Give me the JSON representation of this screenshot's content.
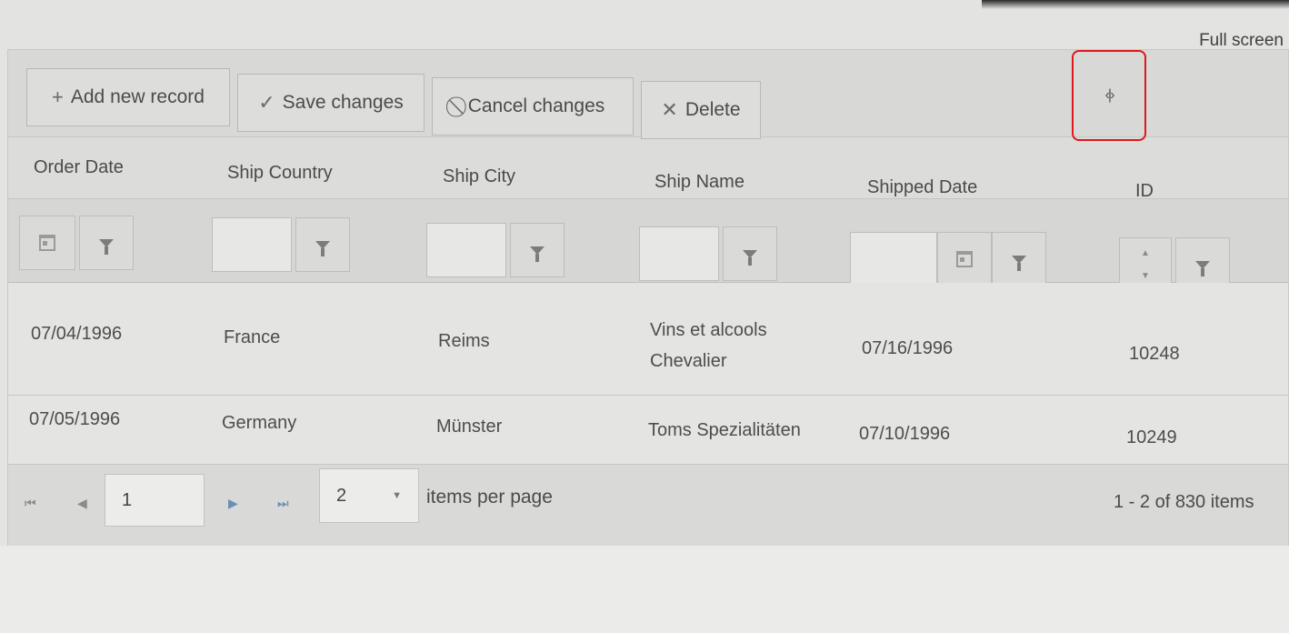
{
  "header": {
    "fullscreen_label": "Full screen"
  },
  "toolbar": {
    "add_label": "Add new record",
    "save_label": "Save changes",
    "cancel_label": "Cancel changes",
    "delete_label": "Delete"
  },
  "columns": [
    "Order Date",
    "Ship Country",
    "Ship City",
    "Ship Name",
    "Shipped Date",
    "ID"
  ],
  "rows": [
    {
      "order_date": "07/04/1996",
      "country": "France",
      "city": "Reims",
      "name_line1": "Vins et alcools",
      "name_line2": "Chevalier",
      "shipped": "07/16/1996",
      "id": "10248"
    },
    {
      "order_date": "07/05/1996",
      "country": "Germany",
      "city": "Münster",
      "name_line1": "Toms Spezialitäten",
      "name_line2": "",
      "shipped": "07/10/1996",
      "id": "10249"
    }
  ],
  "pager": {
    "page": "1",
    "page_size": "2",
    "items_per_page_label": "items per page",
    "info": "1 - 2 of 830 items"
  }
}
